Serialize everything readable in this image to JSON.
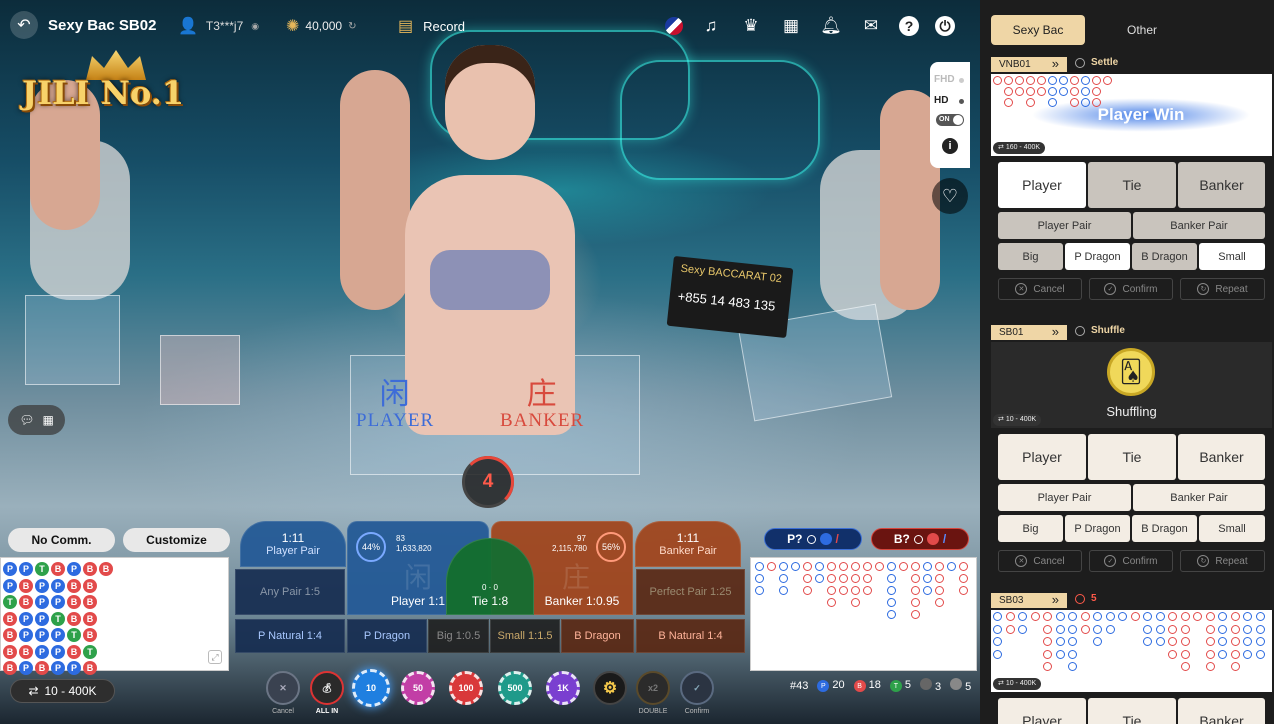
{
  "topbar": {
    "title": "Sexy Bac SB02",
    "user": "T3***j7",
    "balance": "40,000",
    "record_label": "Record"
  },
  "logo": {
    "text": "JILI No.1"
  },
  "quality": {
    "fhd": "FHD",
    "hd": "HD",
    "toggle": "ON"
  },
  "video": {
    "plate_line1": "Sexy BACCARAT 02",
    "plate_line2": "+855 14 483 135",
    "player_cn": "闲",
    "player_en": "PLAYER",
    "banker_cn": "庄",
    "banker_en": "BANKER"
  },
  "countdown": "4",
  "left_controls": {
    "no_comm": "No Comm.",
    "customize": "Customize",
    "limit": "10 - 400K",
    "bead_road": [
      [
        "P",
        "P",
        "T",
        "B",
        "P",
        "B",
        "B",
        "P"
      ],
      [
        "P",
        "B",
        "P",
        "P",
        "B",
        "B"
      ],
      [
        "T",
        "B",
        "P",
        "P",
        "B",
        "B"
      ],
      [
        "B",
        "P",
        "P",
        "T",
        "B",
        "B"
      ],
      [
        "B",
        "P",
        "P",
        "P",
        "T",
        "B"
      ],
      [
        "B",
        "B",
        "P",
        "P",
        "B",
        "T"
      ],
      [
        "B",
        "P",
        "B",
        "P",
        "P",
        "B"
      ]
    ]
  },
  "bets": {
    "player_pair": "Player Pair",
    "player_pair_odds": "1:11",
    "banker_pair": "Banker Pair",
    "banker_pair_odds": "1:11",
    "player": "Player 1:1",
    "player_pct": "44%",
    "player_count": "83",
    "player_amount": "1,633,820",
    "banker": "Banker 1:0.95",
    "banker_pct": "56%",
    "banker_count": "97",
    "banker_amount": "2,115,780",
    "tie": "Tie 1:8",
    "tie_count": "0",
    "tie_amount": "0",
    "any_pair": "Any Pair 1:5",
    "perfect_pair": "Perfect Pair 1:25",
    "p_natural": "P Natural 1:4",
    "p_dragon": "P Dragon",
    "big": "Big 1:0.5",
    "small": "Small 1:1.5",
    "b_dragon": "B Dragon",
    "b_natural": "B Natural 1:4"
  },
  "chips": {
    "cancel": "Cancel",
    "all_in": "ALL IN",
    "values": [
      "10",
      "50",
      "100",
      "500",
      "1K"
    ],
    "double": "DOUBLE",
    "confirm": "Confirm"
  },
  "predict": {
    "p": "P?",
    "b": "B?"
  },
  "stats": {
    "round": "#43",
    "player": "20",
    "banker": "18",
    "tie": "5",
    "p_pair": "3",
    "b_pair": "5"
  },
  "colors": {
    "player": "#2d6be0",
    "banker": "#e24a4a",
    "tie": "#2ea14a",
    "accent": "#efd6a6"
  },
  "side": {
    "tabs": [
      "Sexy Bac",
      "Other"
    ],
    "tables": [
      {
        "name": "VNB01",
        "state": "Settle",
        "limit": "160 - 400K",
        "banner": "Player Win",
        "buttons": {
          "player": "Player",
          "tie": "Tie",
          "banker": "Banker",
          "player_pair": "Player Pair",
          "banker_pair": "Banker Pair",
          "big": "Big",
          "p_dragon": "P Dragon",
          "b_dragon": "B Dragon",
          "small": "Small",
          "cancel": "Cancel",
          "confirm": "Confirm",
          "repeat": "Repeat"
        }
      },
      {
        "name": "SB01",
        "state": "Shuffle",
        "limit": "10 - 400K",
        "banner": "Shuffling",
        "buttons": {
          "player": "Player",
          "tie": "Tie",
          "banker": "Banker",
          "player_pair": "Player Pair",
          "banker_pair": "Banker Pair",
          "big": "Big",
          "p_dragon": "P Dragon",
          "b_dragon": "B Dragon",
          "small": "Small",
          "cancel": "Cancel",
          "confirm": "Confirm",
          "repeat": "Repeat"
        }
      },
      {
        "name": "SB03",
        "state": "5",
        "limit": "10 - 400K",
        "buttons": {
          "player": "Player",
          "tie": "Tie",
          "banker": "Banker"
        }
      }
    ]
  }
}
